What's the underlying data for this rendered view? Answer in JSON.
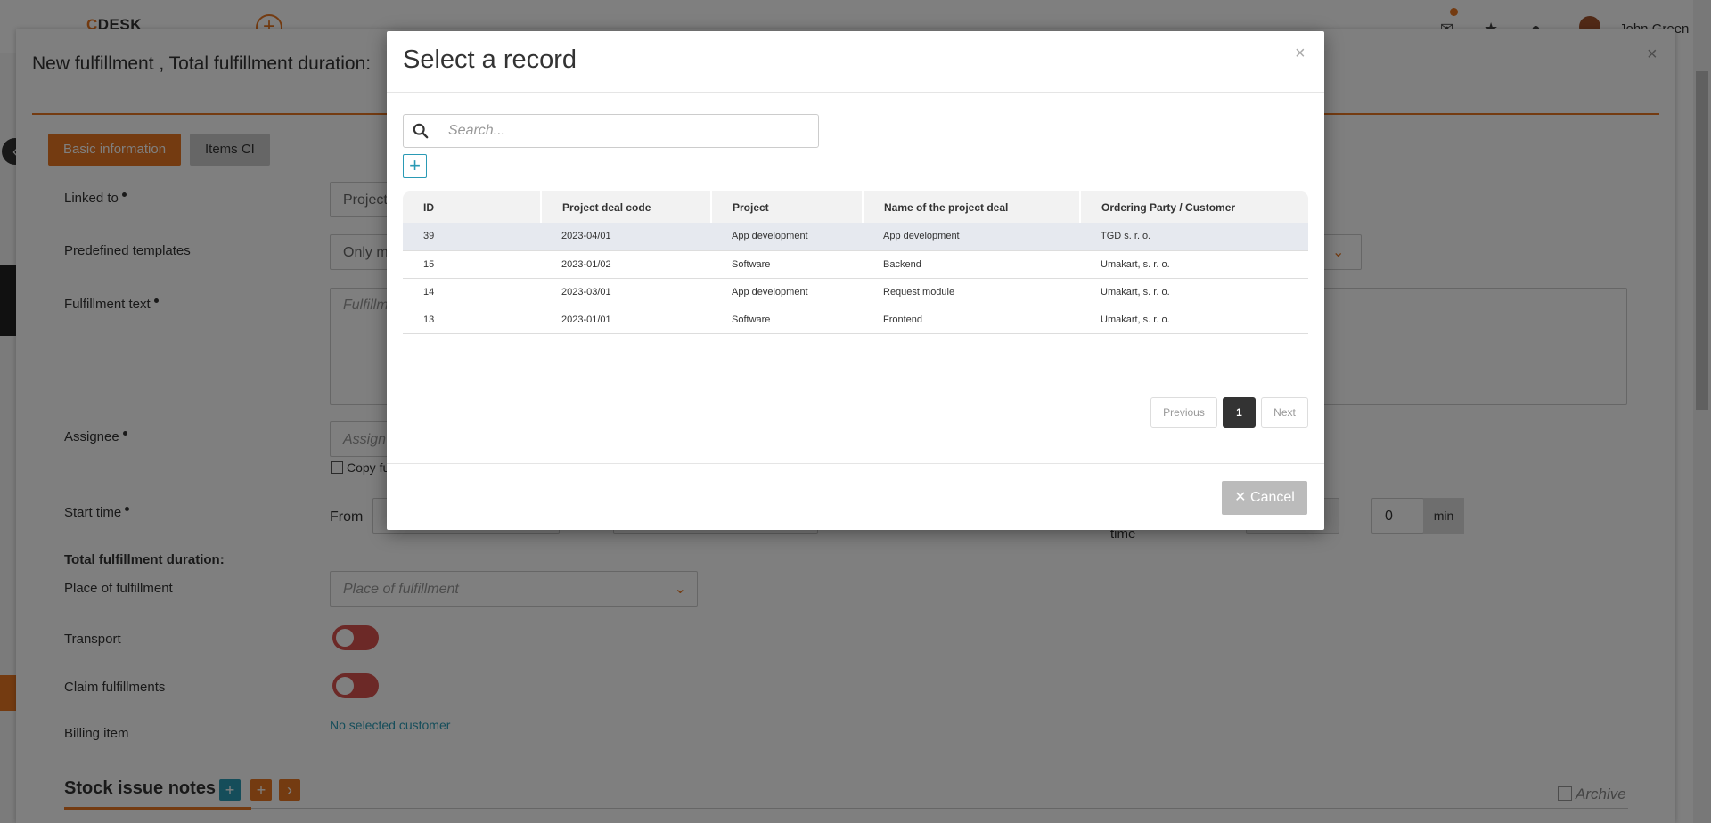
{
  "app": {
    "logo_prefix": "C",
    "logo_text": "DESK",
    "user_name": "John Green"
  },
  "panel": {
    "title": "New fulfillment , Total fulfillment duration:",
    "tabs": [
      "Basic information",
      "Items CI"
    ]
  },
  "form": {
    "linked_to_label": "Linked to",
    "linked_to_value": "Project",
    "predefined_templates_label": "Predefined templates",
    "predefined_templates_value": "Only m",
    "fulfillment_text_label": "Fulfillment text",
    "fulfillment_text_placeholder": "Fulfillm",
    "assignee_label": "Assignee",
    "assignee_placeholder": "Assign",
    "copy_label": "Copy fu",
    "start_time_label": "Start time",
    "from_label": "From",
    "time_label": "time",
    "minutes_value": "0",
    "minutes_unit": "min",
    "total_duration_label": "Total fulfillment duration:",
    "place_label": "Place of fulfillment",
    "place_placeholder": "Place of fulfillment",
    "transport_label": "Transport",
    "claim_label": "Claim fulfillments",
    "billing_label": "Billing item",
    "billing_value": "No selected customer"
  },
  "stock": {
    "title": "Stock issue notes",
    "archive_label": "Archive"
  },
  "modal": {
    "title": "Select a record",
    "close_glyph": "×",
    "search_placeholder": "Search...",
    "add_glyph": "+",
    "columns": [
      "ID",
      "Project deal code",
      "Project",
      "Name of the project deal",
      "Ordering Party / Customer"
    ],
    "rows": [
      [
        "39",
        "2023-04/01",
        "App development",
        "App development",
        "TGD s. r. o."
      ],
      [
        "15",
        "2023-01/02",
        "Software",
        "Backend",
        "Umakart, s. r. o."
      ],
      [
        "14",
        "2023-03/01",
        "App development",
        "Request module",
        "Umakart, s. r. o."
      ],
      [
        "13",
        "2023-01/01",
        "Software",
        "Frontend",
        "Umakart, s. r. o."
      ]
    ],
    "pagination": {
      "previous": "Previous",
      "current": "1",
      "next": "Next"
    },
    "cancel_label": "✕ Cancel"
  },
  "colors": {
    "accent": "#e87722",
    "link": "#2a9ab5",
    "toggle_off": "#d9534f",
    "selected_row": "#e6e9ef"
  }
}
